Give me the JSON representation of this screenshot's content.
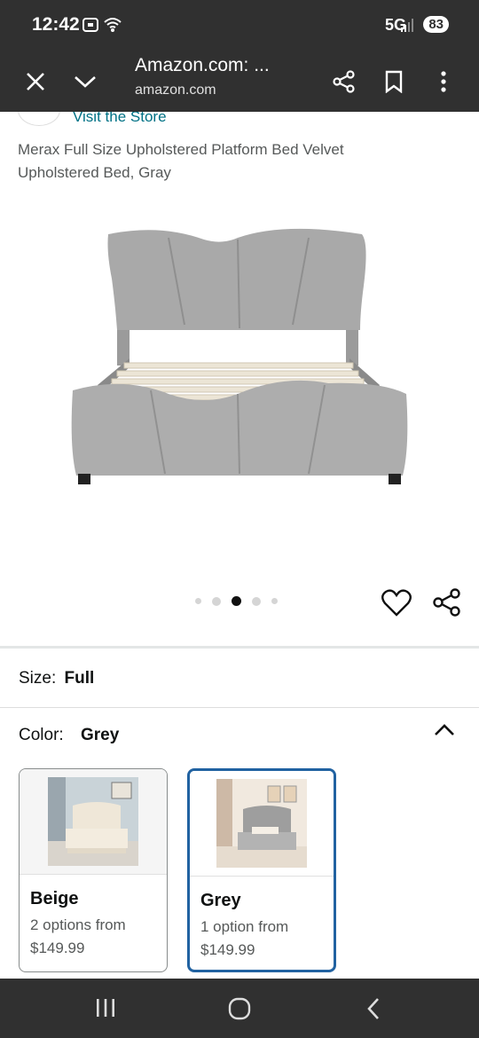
{
  "status": {
    "time": "12:42",
    "network": "5G",
    "battery": "83"
  },
  "toolbar": {
    "title": "Amazon.com: ...",
    "url": "amazon.com"
  },
  "store": {
    "link": "Visit the Store"
  },
  "product": {
    "title": "Merax Full Size Upholstered Platform Bed Velvet Upholstered Bed, Gray"
  },
  "carousel": {
    "count": 5,
    "active_index": 2
  },
  "size": {
    "label": "Size:",
    "value": "Full"
  },
  "color": {
    "label": "Color:",
    "value": "Grey"
  },
  "swatches": [
    {
      "name": "Beige",
      "options": "2 options from",
      "price": "$149.99",
      "selected": false
    },
    {
      "name": "Grey",
      "options": "1 option from",
      "price": "$149.99",
      "selected": true
    }
  ]
}
